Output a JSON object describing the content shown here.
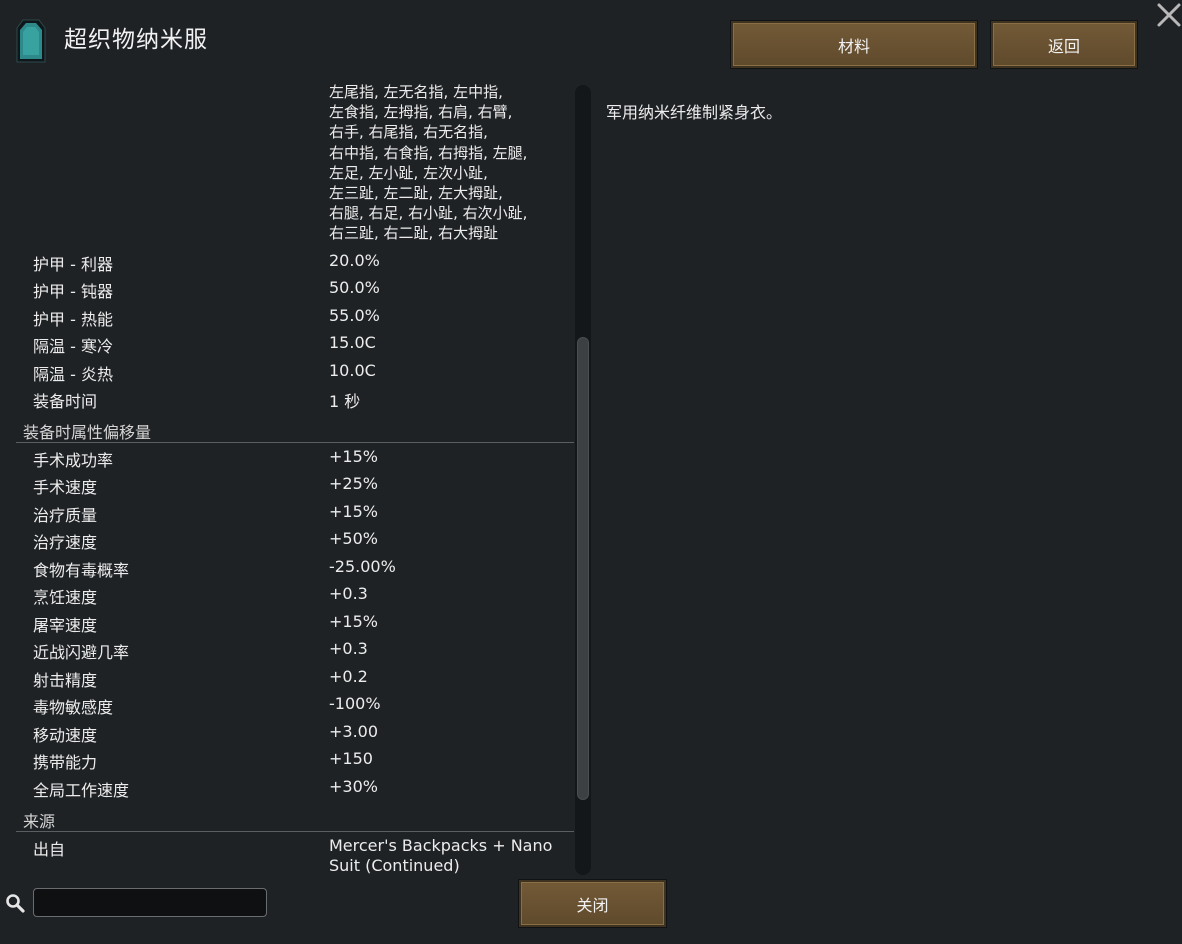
{
  "header": {
    "title": "超织物纳米服",
    "icon": "nano-suit-icon",
    "materials_label": "材料",
    "back_label": "返回",
    "close_icon": "close-x-icon"
  },
  "body_parts_lines": [
    "左尾指, 左无名指, 左中指,",
    "左食指, 左拇指, 右肩, 右臂,",
    "右手, 右尾指, 右无名指,",
    "右中指, 右食指, 右拇指, 左腿,",
    "左足, 左小趾, 左次小趾,",
    "左三趾, 左二趾, 左大拇趾,",
    "右腿, 右足, 右小趾, 右次小趾,",
    "右三趾, 右二趾, 右大拇趾"
  ],
  "stats": [
    {
      "label": "护甲 - 利器",
      "value": "20.0%"
    },
    {
      "label": "护甲 - 钝器",
      "value": "50.0%"
    },
    {
      "label": "护甲 - 热能",
      "value": "55.0%"
    },
    {
      "label": "隔温 - 寒冷",
      "value": "15.0C"
    },
    {
      "label": "隔温 - 炎热",
      "value": "10.0C"
    },
    {
      "label": "装备时间",
      "value": "1 秒"
    }
  ],
  "offsets_section": {
    "title": "装备时属性偏移量",
    "rows": [
      {
        "label": "手术成功率",
        "value": "+15%"
      },
      {
        "label": "手术速度",
        "value": "+25%"
      },
      {
        "label": "治疗质量",
        "value": "+15%"
      },
      {
        "label": "治疗速度",
        "value": "+50%"
      },
      {
        "label": "食物有毒概率",
        "value": "-25.00%"
      },
      {
        "label": "烹饪速度",
        "value": "+0.3"
      },
      {
        "label": "屠宰速度",
        "value": "+15%"
      },
      {
        "label": "近战闪避几率",
        "value": "+0.3"
      },
      {
        "label": "射击精度",
        "value": "+0.2"
      },
      {
        "label": "毒物敏感度",
        "value": "-100%"
      },
      {
        "label": "移动速度",
        "value": "+3.00"
      },
      {
        "label": "携带能力",
        "value": "+150"
      },
      {
        "label": "全局工作速度",
        "value": "+30%"
      }
    ]
  },
  "source_section": {
    "title": "来源",
    "label": "出自",
    "value_lines": [
      "Mercer's Backpacks + Nano",
      "Suit (Continued)"
    ]
  },
  "description": "军用纳米纤维制紧身衣。",
  "footer": {
    "search_icon": "search-icon",
    "search_value": "",
    "close_label": "关闭"
  }
}
